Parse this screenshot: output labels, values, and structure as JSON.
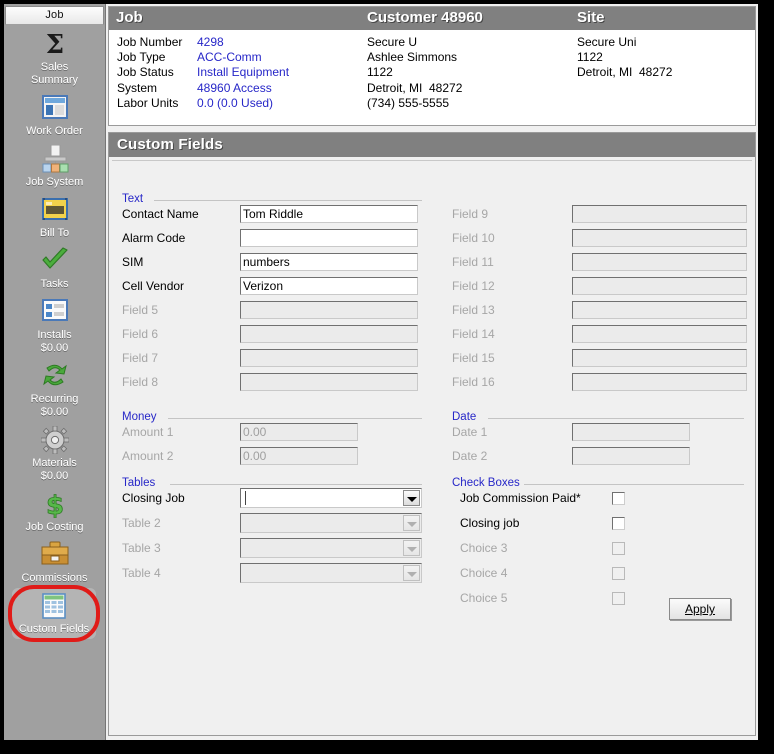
{
  "sidebar": {
    "tab_label": "Job",
    "items": [
      {
        "label": "Sales\nSummary",
        "icon": "sigma-icon"
      },
      {
        "label": "Work Order",
        "icon": "work-order-icon"
      },
      {
        "label": "Job System",
        "icon": "job-system-icon"
      },
      {
        "label": "Bill To",
        "icon": "bill-to-icon"
      },
      {
        "label": "Tasks",
        "icon": "checkmark-icon"
      },
      {
        "label": "Installs\n$0.00",
        "icon": "installs-icon"
      },
      {
        "label": "Recurring\n$0.00",
        "icon": "recurring-icon"
      },
      {
        "label": "Materials\n$0.00",
        "icon": "gear-icon"
      },
      {
        "label": "Job Costing",
        "icon": "dollar-icon"
      },
      {
        "label": "Commissions",
        "icon": "toolbox-icon"
      },
      {
        "label": "Custom Fields",
        "icon": "custom-fields-icon",
        "selected": true,
        "highlighted": true
      }
    ]
  },
  "job_header": {
    "title_job": "Job",
    "title_customer": "Customer 48960",
    "title_site": "Site",
    "labels": [
      "Job Number",
      "Job Type",
      "Job Status",
      "System",
      "Labor Units"
    ],
    "values": [
      "4298",
      "ACC-Comm",
      "Install Equipment",
      "48960 Access",
      "0.0 (0.0 Used)"
    ],
    "customer_lines": [
      "Secure U",
      "Ashlee Simmons",
      "1122",
      "Detroit, MI  48272",
      "(734) 555-5555"
    ],
    "site_lines": [
      "Secure Uni",
      "1122",
      "Detroit, MI  48272"
    ],
    "value_color": "#2727c8"
  },
  "custom_fields": {
    "panel_title": "Custom Fields",
    "groups": {
      "text": "Text",
      "money": "Money",
      "tables": "Tables",
      "date": "Date",
      "checkboxes": "Check Boxes"
    },
    "text_left": [
      {
        "label": "Contact Name",
        "value": "Tom Riddle",
        "disabled": false
      },
      {
        "label": "Alarm Code",
        "value": "",
        "disabled": false
      },
      {
        "label": "SIM",
        "value": "numbers",
        "disabled": false
      },
      {
        "label": "Cell Vendor",
        "value": "Verizon",
        "disabled": false
      },
      {
        "label": "Field 5",
        "value": "",
        "disabled": true
      },
      {
        "label": "Field 6",
        "value": "",
        "disabled": true
      },
      {
        "label": "Field 7",
        "value": "",
        "disabled": true
      },
      {
        "label": "Field 8",
        "value": "",
        "disabled": true
      }
    ],
    "text_right": [
      {
        "label": "Field 9",
        "value": "",
        "disabled": true
      },
      {
        "label": "Field 10",
        "value": "",
        "disabled": true
      },
      {
        "label": "Field 11",
        "value": "",
        "disabled": true
      },
      {
        "label": "Field 12",
        "value": "",
        "disabled": true
      },
      {
        "label": "Field 13",
        "value": "",
        "disabled": true
      },
      {
        "label": "Field 14",
        "value": "",
        "disabled": true
      },
      {
        "label": "Field 15",
        "value": "",
        "disabled": true
      },
      {
        "label": "Field 16",
        "value": "",
        "disabled": true
      }
    ],
    "money": [
      {
        "label": "Amount 1",
        "value": "0.00",
        "disabled": true
      },
      {
        "label": "Amount 2",
        "value": "0.00",
        "disabled": true
      }
    ],
    "tables": [
      {
        "label": "Closing Job",
        "value": "",
        "disabled": false
      },
      {
        "label": "Table 2",
        "value": "",
        "disabled": true
      },
      {
        "label": "Table 3",
        "value": "",
        "disabled": true
      },
      {
        "label": "Table 4",
        "value": "",
        "disabled": true
      }
    ],
    "dates": [
      {
        "label": "Date 1",
        "value": "",
        "disabled": true
      },
      {
        "label": "Date 2",
        "value": "",
        "disabled": true
      }
    ],
    "checkboxes": [
      {
        "label": "Job Commission Paid*",
        "checked": false,
        "disabled": false
      },
      {
        "label": "Closing job",
        "checked": false,
        "disabled": false
      },
      {
        "label": "Choice 3",
        "checked": false,
        "disabled": true
      },
      {
        "label": "Choice 4",
        "checked": false,
        "disabled": true
      },
      {
        "label": "Choice 5",
        "checked": false,
        "disabled": true
      }
    ],
    "apply_button": "Apply"
  }
}
